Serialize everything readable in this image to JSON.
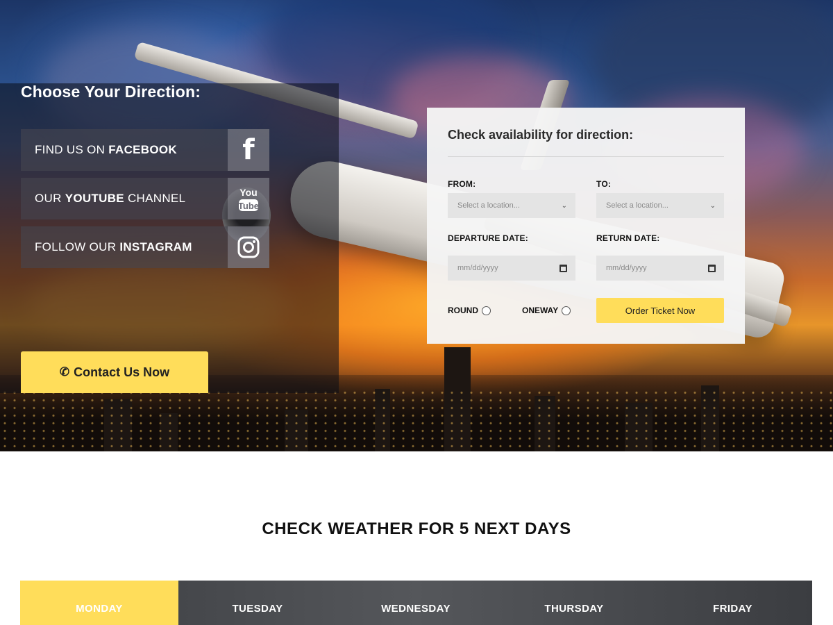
{
  "direction": {
    "title": "Choose Your Direction:",
    "social": [
      {
        "prefix": "FIND US ON ",
        "bold": "FACEBOOK",
        "suffix": "",
        "icon": "facebook-icon",
        "glyph": "f"
      },
      {
        "prefix": "OUR ",
        "bold": "YOUTUBE",
        "suffix": " CHANNEL",
        "icon": "youtube-icon",
        "glyph": "You Tube"
      },
      {
        "prefix": "FOLLOW OUR ",
        "bold": "INSTAGRAM",
        "suffix": "",
        "icon": "instagram-icon",
        "glyph": ""
      }
    ],
    "contact_label": "Contact Us Now",
    "contact_icon": "phone-icon"
  },
  "availability": {
    "title": "Check availability for direction:",
    "from_label": "FROM:",
    "to_label": "TO:",
    "from_placeholder": "Select a location...",
    "to_placeholder": "Select a location...",
    "departure_label": "DEPARTURE DATE:",
    "return_label": "RETURN DATE:",
    "departure_placeholder": "mm/dd/yyyy",
    "return_placeholder": "mm/dd/yyyy",
    "round_label": "ROUND",
    "oneway_label": "ONEWAY",
    "order_label": "Order Ticket Now"
  },
  "weather": {
    "title": "CHECK WEATHER FOR 5 NEXT DAYS",
    "days": [
      "MONDAY",
      "TUESDAY",
      "WEDNESDAY",
      "THURSDAY",
      "FRIDAY"
    ],
    "active_day": "MONDAY"
  },
  "colors": {
    "accent": "#ffdd5a",
    "dark_panel": "#0a0c16",
    "day_bar": "#4a4c50"
  }
}
